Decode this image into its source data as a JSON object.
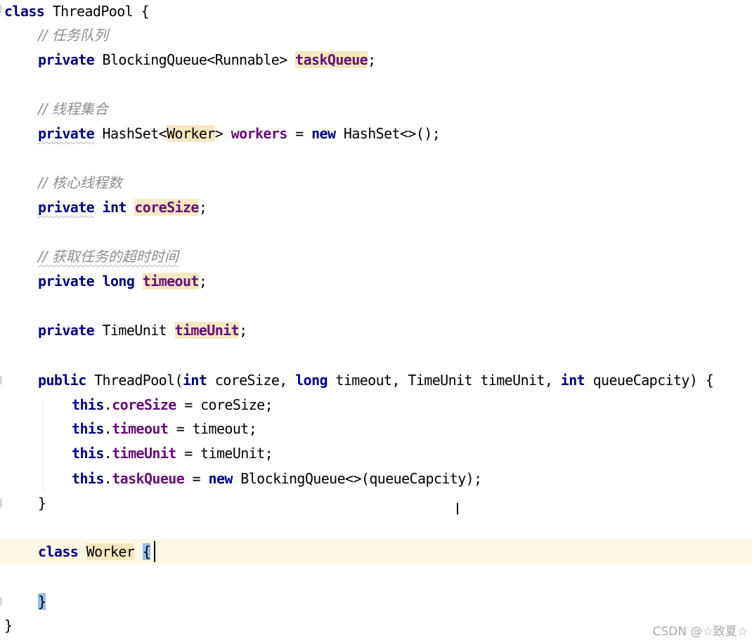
{
  "editor": {
    "lines": {
      "l1": {
        "kw": "class",
        "name": "ThreadPool",
        "brace": "{"
      },
      "l2": {
        "comment": "// 任务队列"
      },
      "l3": {
        "kw": "private",
        "type": "BlockingQueue<Runnable>",
        "field": "taskQueue",
        "semi": ";"
      },
      "l5": {
        "comment": "// 线程集合"
      },
      "l6": {
        "kw": "private",
        "type_a": "HashSet<",
        "type_b": "Worker",
        "type_c": ">",
        "field": "workers",
        "op": "=",
        "kw_new": "new",
        "expr": "HashSet<>();"
      },
      "l8": {
        "comment": "// 核心线程数"
      },
      "l9": {
        "kw": "private",
        "kw2": "int",
        "field": "coreSize",
        "semi": ";"
      },
      "l11": {
        "comment": "// 获取任务的超时时间"
      },
      "l12": {
        "kw": "private",
        "kw2": "long",
        "field": "timeout",
        "semi": ";"
      },
      "l14": {
        "kw": "private",
        "type": "TimeUnit",
        "field": "timeUnit",
        "semi": ";"
      },
      "l16": {
        "kw": "public",
        "name": "ThreadPool(",
        "kw_int": "int",
        "p1": "coreSize,",
        "kw_long": "long",
        "p2": "timeout,",
        "p3": "TimeUnit timeUnit,",
        "kw_int2": "int",
        "p4": "queueCapcity) {"
      },
      "l17": {
        "kw": "this",
        "dot": ".",
        "field": "coreSize",
        "rest": " = coreSize;"
      },
      "l18": {
        "kw": "this",
        "dot": ".",
        "field": "timeout",
        "rest": " = timeout;"
      },
      "l19": {
        "kw": "this",
        "dot": ".",
        "field": "timeUnit",
        "rest": " = timeUnit;"
      },
      "l20": {
        "kw": "this",
        "dot": ".",
        "field": "taskQueue",
        "rest": " = ",
        "kw_new": "new",
        "expr": " BlockingQueue<>(queueCapcity);"
      },
      "l21": {
        "brace": "}"
      },
      "l23": {
        "kw": "class",
        "name": "Worker",
        "brace": "{"
      },
      "l25": {
        "brace": "}"
      },
      "l26": {
        "brace": "}"
      }
    }
  },
  "mouse_cursor": "I",
  "watermark": "CSDN @☆致夏☆",
  "colors": {
    "keyword": "#000080",
    "field": "#660e7a",
    "comment": "#8c8c8c",
    "usage_highlight": "#f6e8c1",
    "brace_match": "#99bde8",
    "caret_row": "#fdf8e4"
  }
}
